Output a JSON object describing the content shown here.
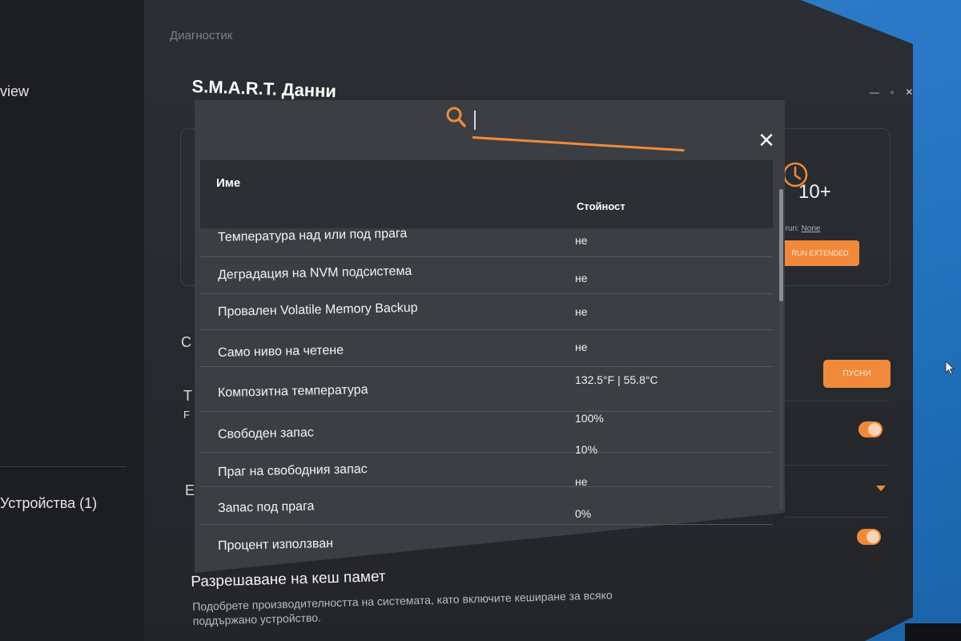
{
  "colors": {
    "accent": "#f08a3a",
    "modal_bg": "#3b3e43",
    "table_header_bg": "#2c2f33",
    "app_bg": "#26292e",
    "desktop": "#2a78c6"
  },
  "sidebar": {
    "items": [
      {
        "label": "view"
      },
      {
        "label": "Устройства (1)"
      }
    ]
  },
  "header": {
    "breadcrumb": "Диагностик"
  },
  "page": {
    "title": "S.M.A.R.T. Данни"
  },
  "background_panel": {
    "clock_badge": "10+",
    "last_run_label": "t run:",
    "last_run_value": "None",
    "run_extended_button": "RUN EXTENDED",
    "launch_button": "ПУСНИ",
    "section_letters": [
      "C",
      "T",
      "F",
      "E"
    ]
  },
  "cache_section": {
    "title": "Разрешаване на кеш памет",
    "description": "Подобрете производителността на системата, като включите кеширане за всяко поддържано устройство."
  },
  "search": {
    "icon": "search-icon",
    "value": "",
    "placeholder": ""
  },
  "modal": {
    "close_icon": "close-icon",
    "columns": {
      "name": "Име",
      "value": "Стойност"
    },
    "rows": [
      {
        "name": "Температура над или под прага",
        "value": "не"
      },
      {
        "name": "Деградация на NVM подсистема",
        "value": "не"
      },
      {
        "name": "Провален Volatile Memory Backup",
        "value": "не"
      },
      {
        "name": "Само ниво на четене",
        "value": "не"
      },
      {
        "name": "Композитна температура",
        "value": "132.5°F | 55.8°C"
      },
      {
        "name": "Свободен запас",
        "value": "100%"
      },
      {
        "name": "Праг на свободния запас",
        "value": "10%"
      },
      {
        "name": "Запас под прага",
        "value": "не"
      },
      {
        "name": "Процент използван",
        "value": "0%"
      }
    ]
  }
}
